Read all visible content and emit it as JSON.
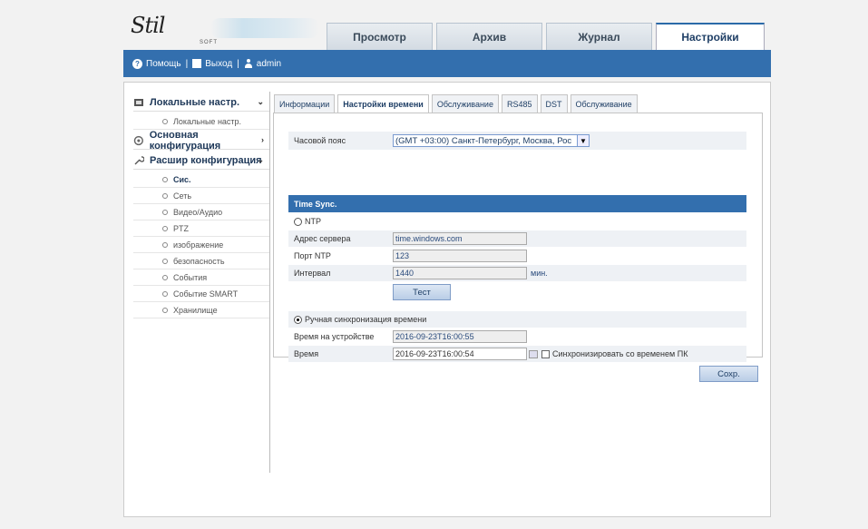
{
  "logo": {
    "text": "Stil",
    "sub": "SOFT"
  },
  "nav_tabs": [
    "Просмотр",
    "Архив",
    "Журнал",
    "Настройки"
  ],
  "active_tab": "Настройки",
  "topbar": {
    "help": "Помощь",
    "logout": "Выход",
    "user": "admin"
  },
  "sidebar": {
    "local": {
      "label": "Локальные настр.",
      "items": [
        "Локальные настр."
      ]
    },
    "basic": {
      "label": "Основная конфигурация"
    },
    "advanced": {
      "label": "Расшир конфигурация",
      "items": [
        "Сис.",
        "Сеть",
        "Видео/Аудио",
        "PTZ",
        "изображение",
        "безопасность",
        "События",
        "Событие SMART",
        "Хранилище"
      ]
    }
  },
  "sub_tabs": [
    "Информации",
    "Настройки времени",
    "Обслуживание",
    "RS485",
    "DST",
    "Обслуживание"
  ],
  "active_sub_tab": "Настройки времени",
  "form": {
    "timezone_label": "Часовой пояс",
    "timezone_value": "(GMT +03:00) Санкт-Петербург, Москва, Рос",
    "timesync_header": "Time Sync.",
    "ntp_label": "NTP",
    "server_label": "Адрес сервера",
    "server_value": "time.windows.com",
    "port_label": "Порт NTP",
    "port_value": "123",
    "interval_label": "Интервал",
    "interval_value": "1440",
    "interval_unit": "мин.",
    "test_button": "Тест",
    "manual_label": "Ручная синхронизация времени",
    "device_time_label": "Время на устройстве",
    "device_time_value": "2016-09-23T16:00:55",
    "time_label": "Время",
    "time_value": "2016-09-23T16:00:54",
    "sync_pc_label": "Синхронизировать со временем ПК",
    "save_button": "Сохр."
  },
  "colors": {
    "accent": "#336fae"
  }
}
